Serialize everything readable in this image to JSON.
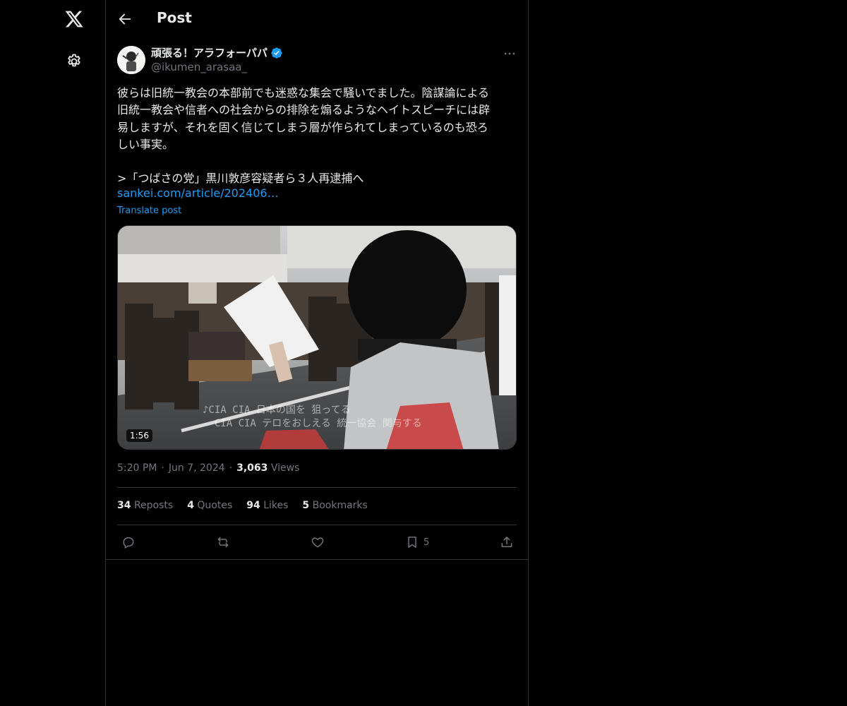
{
  "header": {
    "title": "Post",
    "back_icon": "arrow-left-icon"
  },
  "left_rail": {
    "logo_icon": "x-logo-icon",
    "settings_icon": "gear-icon"
  },
  "author": {
    "display_name": "頑張る！アラフォーパパ",
    "handle": "@ikumen_arasaa_",
    "verified": true,
    "verified_color": "#1d9bf0"
  },
  "post": {
    "text": "彼らは旧統一教会の本部前でも迷惑な集会で騒いでました。陰謀論による\n旧統一教会や信者への社会からの排除を煽るようなヘイトスピーチには辟\n易しますが、それを固く信じてしまう層が作られてしまっているのも恐ろ\nしい事実。\n\n>「つばさの党」黒川敦彦容疑者ら３人再逮捕へ",
    "link_text": "sankei.com/article/202406…",
    "translate_label": "Translate post"
  },
  "media": {
    "duration": "1:56",
    "subtitle_line1": "♪CIA CIA 日本の国を 狙ってる",
    "subtitle_line2": "CIA CIA テロをおしえる 統一協会 関与する"
  },
  "meta": {
    "time": "5:20 PM",
    "date": "Jun 7, 2024",
    "views_count": "3,063",
    "views_label": "Views",
    "separator": "·"
  },
  "stats": {
    "reposts_count": "34",
    "reposts_label": "Reposts",
    "quotes_count": "4",
    "quotes_label": "Quotes",
    "likes_count": "94",
    "likes_label": "Likes",
    "bookmarks_count": "5",
    "bookmarks_label": "Bookmarks"
  },
  "actions": {
    "bookmark_count": "5"
  },
  "colors": {
    "background": "#000000",
    "text": "#e7e9ea",
    "muted": "#71767b",
    "link": "#1d9bf0",
    "border": "#2f3336"
  }
}
